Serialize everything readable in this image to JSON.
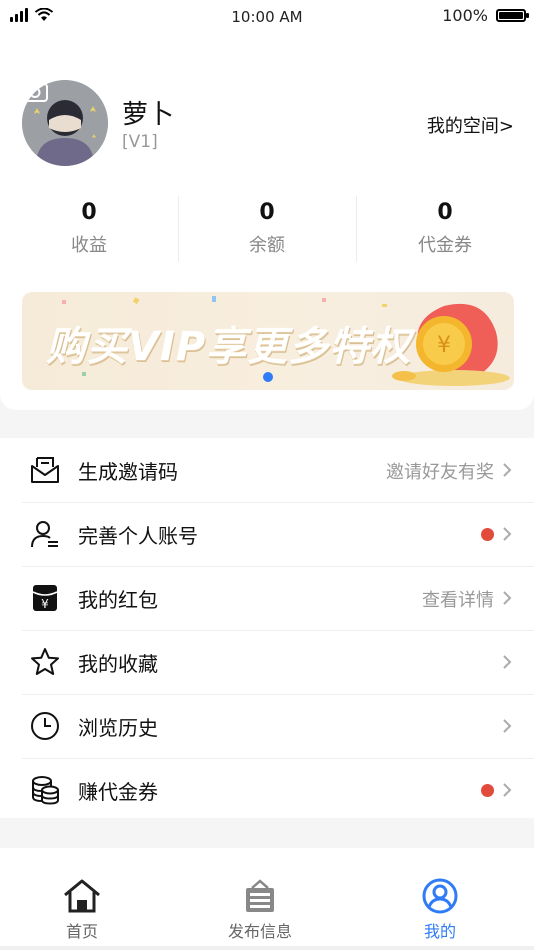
{
  "status_bar": {
    "time": "10:00 AM",
    "battery_pct": "100%"
  },
  "profile": {
    "username": "萝卜",
    "level": "[V1]",
    "space_link": "我的空间>"
  },
  "stats": [
    {
      "value": "0",
      "label": "收益"
    },
    {
      "value": "0",
      "label": "余额"
    },
    {
      "value": "0",
      "label": "代金券"
    }
  ],
  "banner": {
    "text": "购买VIP享更多特权",
    "active_slide": 1,
    "slide_count": 1
  },
  "menu": [
    {
      "label": "生成邀请码",
      "hint": "邀请好友有奖",
      "icon": "envelope-icon",
      "badge": false
    },
    {
      "label": "完善个人账号",
      "hint": "",
      "icon": "user-profile-icon",
      "badge": true
    },
    {
      "label": "我的红包",
      "hint": "查看详情",
      "icon": "red-packet-icon",
      "badge": false
    },
    {
      "label": "我的收藏",
      "hint": "",
      "icon": "star-icon",
      "badge": false
    },
    {
      "label": "浏览历史",
      "hint": "",
      "icon": "clock-icon",
      "badge": false
    },
    {
      "label": "赚代金券",
      "hint": "",
      "icon": "coins-icon",
      "badge": true
    }
  ],
  "tabs": [
    {
      "label": "首页",
      "icon": "home-icon",
      "active": false
    },
    {
      "label": "发布信息",
      "icon": "post-icon",
      "active": false
    },
    {
      "label": "我的",
      "icon": "user-circle-icon",
      "active": true
    }
  ],
  "colors": {
    "accent": "#2f7cf6",
    "badge": "#e24a3b",
    "muted": "#999999"
  }
}
